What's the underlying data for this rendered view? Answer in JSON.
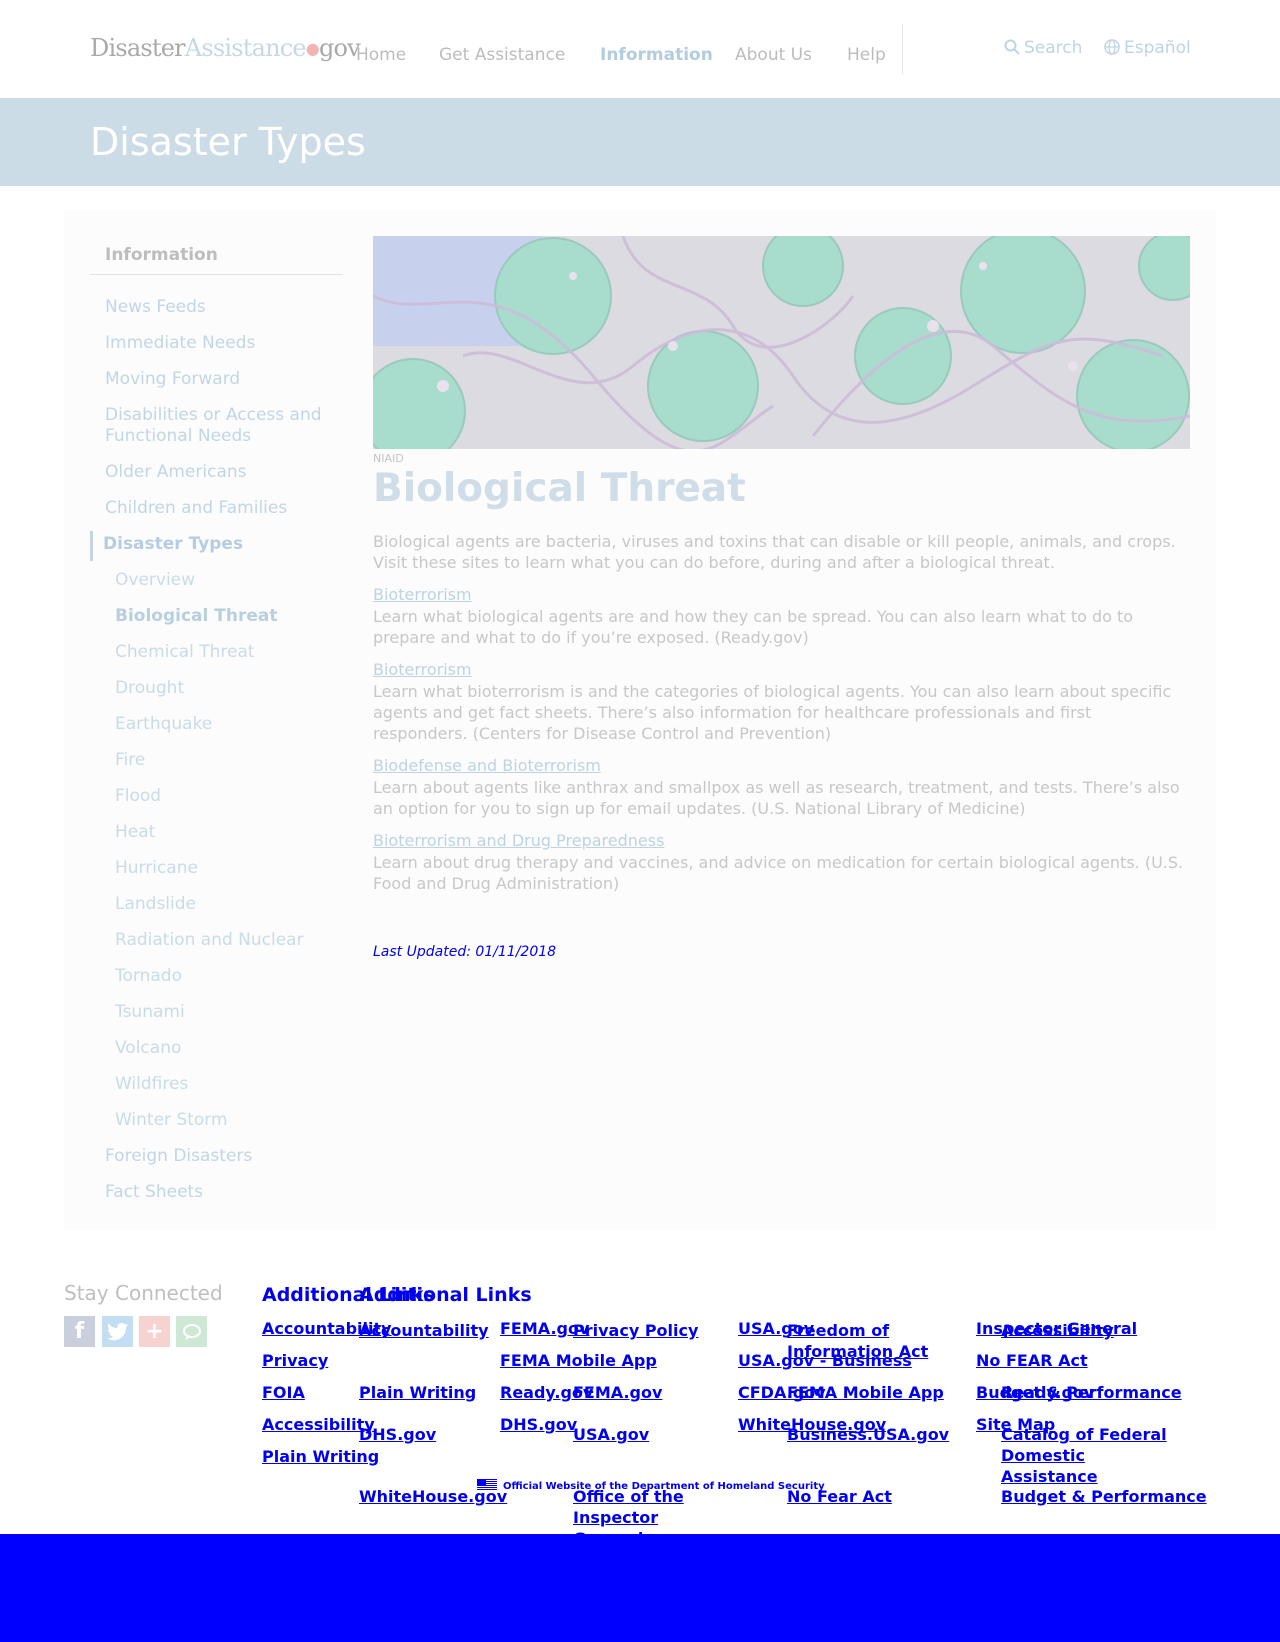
{
  "header": {
    "logo": {
      "part1": "Disaster",
      "part2": "Assistance",
      "part3": "gov"
    },
    "nav": [
      "Home",
      "Get Assistance",
      "Information",
      "About Us",
      "Help"
    ],
    "search_label": "Search",
    "language_label": "Español"
  },
  "banner": {
    "title": "Disaster Types"
  },
  "sidebar": {
    "heading": "Information",
    "top_items": [
      "News Feeds",
      "Immediate Needs",
      "Moving Forward",
      "Disabilities or Access and Functional Needs",
      "Older Americans",
      "Children and Families"
    ],
    "section": "Disaster Types",
    "sub_items": [
      "Overview",
      "Biological Threat",
      "Chemical Threat",
      "Drought",
      "Earthquake",
      "Fire",
      "Flood",
      "Heat",
      "Hurricane",
      "Landslide",
      "Radiation and Nuclear",
      "Tornado",
      "Tsunami",
      "Volcano",
      "Wildfires",
      "Winter Storm"
    ],
    "bottom_items": [
      "Foreign Disasters",
      "Fact Sheets"
    ]
  },
  "main": {
    "image_caption": "NIAID",
    "title": "Biological Threat",
    "intro": "Biological agents are bacteria, viruses and toxins that can disable or kill people, animals, and crops. Visit these sites to learn what you can do before, during and after a biological threat.",
    "resources": [
      {
        "link": "Bioterrorism",
        "text": "Learn what biological agents are and how they can be spread. You can also learn what to do to prepare and what to do if you’re exposed. (Ready.gov)"
      },
      {
        "link": "Bioterrorism",
        "text": "Learn what bioterrorism is and the categories of biological agents. You can also learn about specific agents and get fact sheets. There’s also information for healthcare professionals and first responders. (Centers for Disease Control and Prevention)"
      },
      {
        "link": "Biodefense and Bioterrorism",
        "text": "Learn about agents like anthrax and smallpox as well as research, treatment, and tests. There’s also an option for you to sign up for email updates. (U.S. National Library of Medicine)"
      },
      {
        "link": "Bioterrorism and Drug Preparedness",
        "text": "Learn about drug therapy and vaccines, and advice on medication for certain biological agents. (U.S. Food and Drug Administration)"
      }
    ],
    "last_updated": "Last Updated: 01/11/2018"
  },
  "footer": {
    "stay_connected": "Stay Connected",
    "social_icons": [
      "facebook-icon",
      "twitter-icon",
      "google-plus-icon",
      "chat-icon"
    ],
    "title_a": "Additional Links",
    "title_b": "Additional Links",
    "layer_a": [
      [
        "Accountability",
        "Privacy",
        "FOIA",
        "Accessibility",
        "Plain Writing"
      ],
      [
        "FEMA.gov",
        "FEMA Mobile App",
        "Ready.gov",
        "DHS.gov"
      ],
      [
        "USA.gov",
        "USA.gov - Business",
        "CFDA.gov",
        "WhiteHouse.gov"
      ],
      [
        "Inspector General",
        "No FEAR Act",
        "Budget & Performance",
        "Site Map"
      ]
    ],
    "layer_b": [
      [
        "Accountability",
        "Plain Writing",
        "DHS.gov",
        "WhiteHouse.gov"
      ],
      [
        "Privacy Policy",
        "FEMA.gov",
        "USA.gov",
        "Office of the Inspector General"
      ],
      [
        "Freedom of Information Act",
        "FEMA Mobile App",
        "Business.USA.gov",
        "No Fear Act"
      ],
      [
        "Accessibility",
        "Ready.gov",
        "Catalog of Federal Domestic Assistance",
        "Budget & Performance"
      ]
    ],
    "official": "Official Website of the Department of Homeland Security"
  },
  "colors": {
    "bottom_bar": "#0000ff",
    "banner": "#ccdce6",
    "link_blue": "#0000ee"
  }
}
